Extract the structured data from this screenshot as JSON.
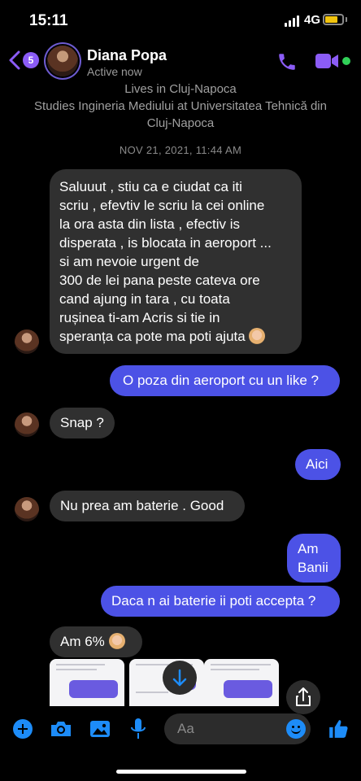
{
  "status_bar": {
    "time": "15:11",
    "network": "4G"
  },
  "header": {
    "back_count": "5",
    "contact_name": "Diana Popa",
    "contact_status": "Active now"
  },
  "profile_info": {
    "lives": "Lives in Cluj-Napoca",
    "studies": "Studies Ingineria Mediului at Universitatea Tehnică din Cluj-Napoca"
  },
  "timestamp": "NOV 21, 2021, 11:44 AM",
  "messages": [
    {
      "from": "them",
      "lines": [
        "Saluuut , stiu ca e ciudat ca iti",
        "scriu , efevtiv le scriu la cei online",
        "la ora asta din lista , efectiv is",
        "disperata , is blocata in aeroport ...",
        "si am nevoie urgent de",
        "300 de  lei pana peste cateva ore",
        "cand ajung in tara , cu toata",
        "rușinea ti-am Acris si tie in",
        "speranța ca pote ma poti ajuta"
      ]
    },
    {
      "from": "me",
      "text": "O poza din aeroport cu un like ?"
    },
    {
      "from": "them",
      "text": "Snap ?"
    },
    {
      "from": "me",
      "text": "Aici"
    },
    {
      "from": "them",
      "text": "Nu prea am baterie . Good"
    },
    {
      "from": "me",
      "lines": [
        "Am",
        "Banii"
      ]
    },
    {
      "from": "me",
      "text": "Daca n ai baterie ii poti accepta ?"
    },
    {
      "from": "them",
      "text": "Am 6%"
    }
  ],
  "composer": {
    "placeholder": "Aa"
  },
  "colors": {
    "accent": "#8b5cf6",
    "outgoing_bubble": "#4c52e6",
    "incoming_bubble": "#303030",
    "online": "#31d158",
    "battery": "#f2c40e"
  }
}
